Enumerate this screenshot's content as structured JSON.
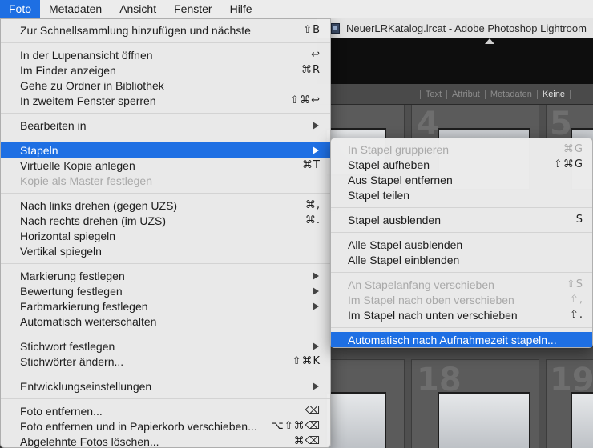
{
  "menubar": {
    "items": [
      "Foto",
      "Metadaten",
      "Ansicht",
      "Fenster",
      "Hilfe"
    ],
    "active": "Foto"
  },
  "window": {
    "title": "NeuerLRKatalog.lrcat - Adobe Photoshop Lightroom",
    "filter_bar": [
      "Text",
      "Attribut",
      "Metadaten",
      "Keine"
    ],
    "filter_active": "Keine",
    "grid_numbers": [
      "4",
      "5",
      "18",
      "19"
    ]
  },
  "foto_menu": {
    "groups": [
      [
        {
          "label": "Zur Schnellsammlung hinzufügen und nächste",
          "shortcut": "⇧B"
        }
      ],
      [
        {
          "label": "In der Lupenansicht öffnen",
          "shortcut": "↩"
        },
        {
          "label": "Im Finder anzeigen",
          "shortcut": "⌘R"
        },
        {
          "label": "Gehe zu Ordner in Bibliothek",
          "shortcut": ""
        },
        {
          "label": "In zweitem Fenster sperren",
          "shortcut": "⇧⌘↩"
        }
      ],
      [
        {
          "label": "Bearbeiten in",
          "submenu": true
        }
      ],
      [
        {
          "label": "Stapeln",
          "submenu": true,
          "highlighted": true
        },
        {
          "label": "Virtuelle Kopie anlegen",
          "shortcut": "⌘T"
        },
        {
          "label": "Kopie als Master festlegen",
          "disabled": true
        }
      ],
      [
        {
          "label": "Nach links drehen (gegen UZS)",
          "shortcut": "⌘,"
        },
        {
          "label": "Nach rechts drehen (im UZS)",
          "shortcut": "⌘."
        },
        {
          "label": "Horizontal spiegeln",
          "shortcut": ""
        },
        {
          "label": "Vertikal spiegeln",
          "shortcut": ""
        }
      ],
      [
        {
          "label": "Markierung festlegen",
          "submenu": true
        },
        {
          "label": "Bewertung festlegen",
          "submenu": true
        },
        {
          "label": "Farbmarkierung festlegen",
          "submenu": true
        },
        {
          "label": "Automatisch weiterschalten",
          "shortcut": ""
        }
      ],
      [
        {
          "label": "Stichwort festlegen",
          "submenu": true
        },
        {
          "label": "Stichwörter ändern...",
          "shortcut": "⇧⌘K"
        }
      ],
      [
        {
          "label": "Entwicklungseinstellungen",
          "submenu": true
        }
      ],
      [
        {
          "label": "Foto entfernen...",
          "shortcut": "⌫"
        },
        {
          "label": "Foto entfernen und in Papierkorb verschieben...",
          "shortcut": "⌥⇧⌘⌫"
        },
        {
          "label": "Abgelehnte Fotos löschen...",
          "shortcut": "⌘⌫"
        }
      ]
    ]
  },
  "stapeln_menu": {
    "groups": [
      [
        {
          "label": "In Stapel gruppieren",
          "shortcut": "⌘G",
          "disabled": true
        },
        {
          "label": "Stapel aufheben",
          "shortcut": "⇧⌘G"
        },
        {
          "label": "Aus Stapel entfernen",
          "shortcut": ""
        },
        {
          "label": "Stapel teilen",
          "shortcut": ""
        }
      ],
      [
        {
          "label": "Stapel ausblenden",
          "shortcut": "S"
        }
      ],
      [
        {
          "label": "Alle Stapel ausblenden",
          "shortcut": ""
        },
        {
          "label": "Alle Stapel einblenden",
          "shortcut": ""
        }
      ],
      [
        {
          "label": "An Stapelanfang verschieben",
          "shortcut": "⇧S",
          "disabled": true
        },
        {
          "label": "Im Stapel nach oben verschieben",
          "shortcut": "⇧,",
          "disabled": true
        },
        {
          "label": "Im Stapel nach unten verschieben",
          "shortcut": "⇧."
        }
      ],
      [
        {
          "label": "Automatisch nach Aufnahmezeit stapeln...",
          "shortcut": "",
          "highlighted": true
        }
      ]
    ]
  }
}
